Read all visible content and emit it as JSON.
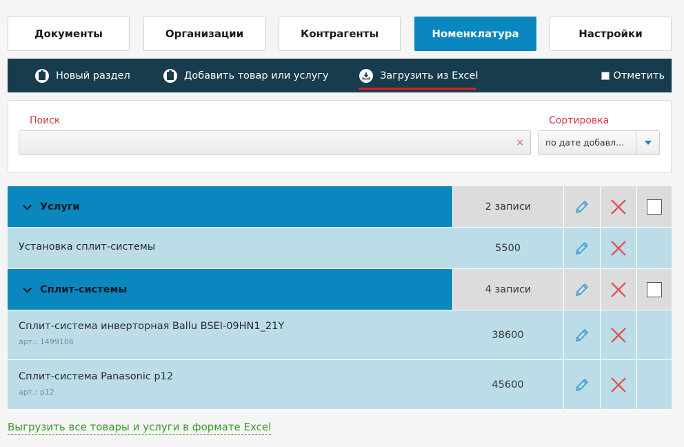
{
  "tabs": [
    {
      "label": "Документы",
      "active": false
    },
    {
      "label": "Организации",
      "active": false
    },
    {
      "label": "Контрагенты",
      "active": false
    },
    {
      "label": "Номенклатура",
      "active": true
    },
    {
      "label": "Настройки",
      "active": false
    }
  ],
  "toolbar": {
    "new_section": "Новый раздел",
    "add_item": "Добавить товар или услугу",
    "import_excel": "Загрузить из Excel",
    "mark": "Отметить"
  },
  "filter": {
    "search_label": "Поиск",
    "search_value": "",
    "clear_icon": "×",
    "sort_label": "Сортировка",
    "sort_value": "по дате добавл..."
  },
  "groups": [
    {
      "name": "Услуги",
      "count": "2 записи",
      "items": [
        {
          "name": "Установка сплит-системы",
          "sku": "",
          "price": "5500"
        }
      ]
    },
    {
      "name": "Сплит-системы",
      "count": "4 записи",
      "items": [
        {
          "name": "Сплит-система инверторная Ballu BSEI-09HN1_21Y",
          "sku": "арт.: 1499106",
          "price": "38600"
        },
        {
          "name": "Сплит-система Panasonic p12",
          "sku": "арт.: p12",
          "price": "45600"
        }
      ]
    }
  ],
  "icons": {
    "edit": "pencil-icon",
    "delete": "cross-icon",
    "section": "clipboard-icon",
    "import": "download-icon"
  },
  "colors": {
    "accent": "#0a87be",
    "toolbar": "#173c4d",
    "row": "#bcdde8",
    "delete": "#e05555",
    "link": "#3a9a2a"
  },
  "export_link": "Выгрузить все товары и услуги в формате Excel"
}
